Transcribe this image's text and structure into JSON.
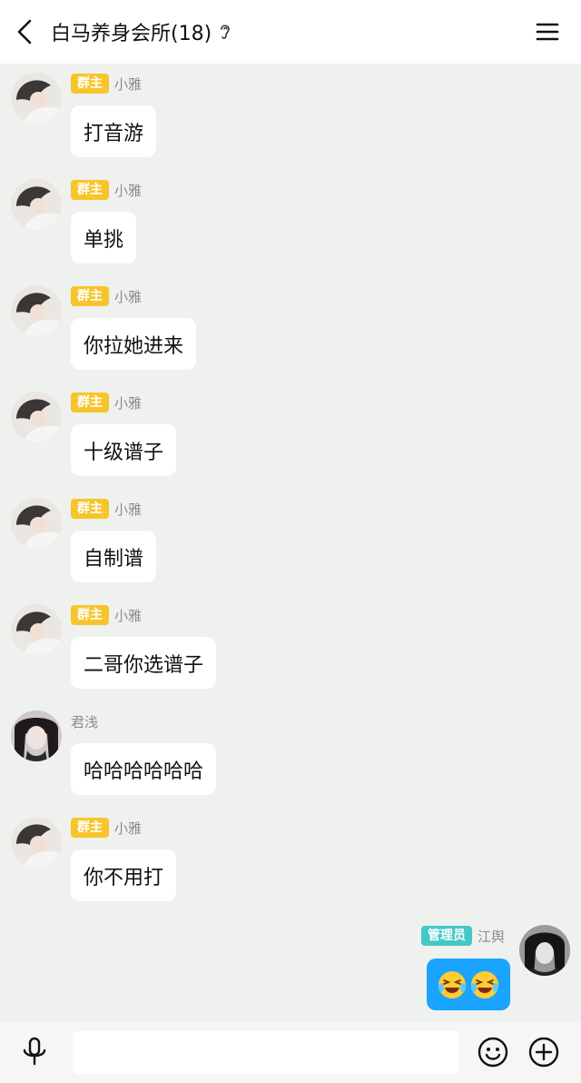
{
  "header": {
    "title": "白马养身会所(18)",
    "back_icon": "chevron-left-icon",
    "listen_icon": "ear-icon",
    "menu_icon": "hamburger-menu-icon"
  },
  "messages": [
    {
      "badge": "群主",
      "sender": "小雅",
      "text": "打音游"
    },
    {
      "badge": "群主",
      "sender": "小雅",
      "text": "单挑"
    },
    {
      "badge": "群主",
      "sender": "小雅",
      "text": "你拉她进来"
    },
    {
      "badge": "群主",
      "sender": "小雅",
      "text": "十级谱子"
    },
    {
      "badge": "群主",
      "sender": "小雅",
      "text": "自制谱"
    },
    {
      "badge": "群主",
      "sender": "小雅",
      "text": "二哥你选谱子"
    },
    {
      "badge": "",
      "sender": "君浅",
      "text": "哈哈哈哈哈哈"
    },
    {
      "badge": "群主",
      "sender": "小雅",
      "text": "你不用打"
    }
  ],
  "self_message": {
    "badge": "管理员",
    "sender": "江舆",
    "content_icons": [
      "laughing-face-icon",
      "laughing-face-icon"
    ]
  },
  "input_bar": {
    "input_value": "",
    "mic_icon": "microphone-icon",
    "emoji_icon": "smiley-icon",
    "plus_icon": "plus-circle-icon"
  },
  "colors": {
    "background": "#eef1ed",
    "owner_badge": "#f7c52b",
    "admin_badge": "#44c8c6",
    "self_bubble": "#1aa3ff"
  }
}
